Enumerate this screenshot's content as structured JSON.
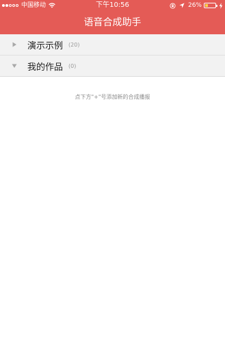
{
  "status_bar": {
    "carrier": "中国移动",
    "time": "下午10:56",
    "battery_percent": "26%",
    "battery_level": 0.26,
    "battery_color": "#f7d54a"
  },
  "nav": {
    "title": "语音合成助手",
    "background_color": "#e45b56"
  },
  "sections": [
    {
      "title": "演示示例",
      "count": "(20)",
      "expanded": false,
      "icon": "triangle-right-icon"
    },
    {
      "title": "我的作品",
      "count": "(0)",
      "expanded": true,
      "icon": "triangle-down-icon"
    }
  ],
  "empty_hint": "点下方\"+\"号添加新的合成播报"
}
